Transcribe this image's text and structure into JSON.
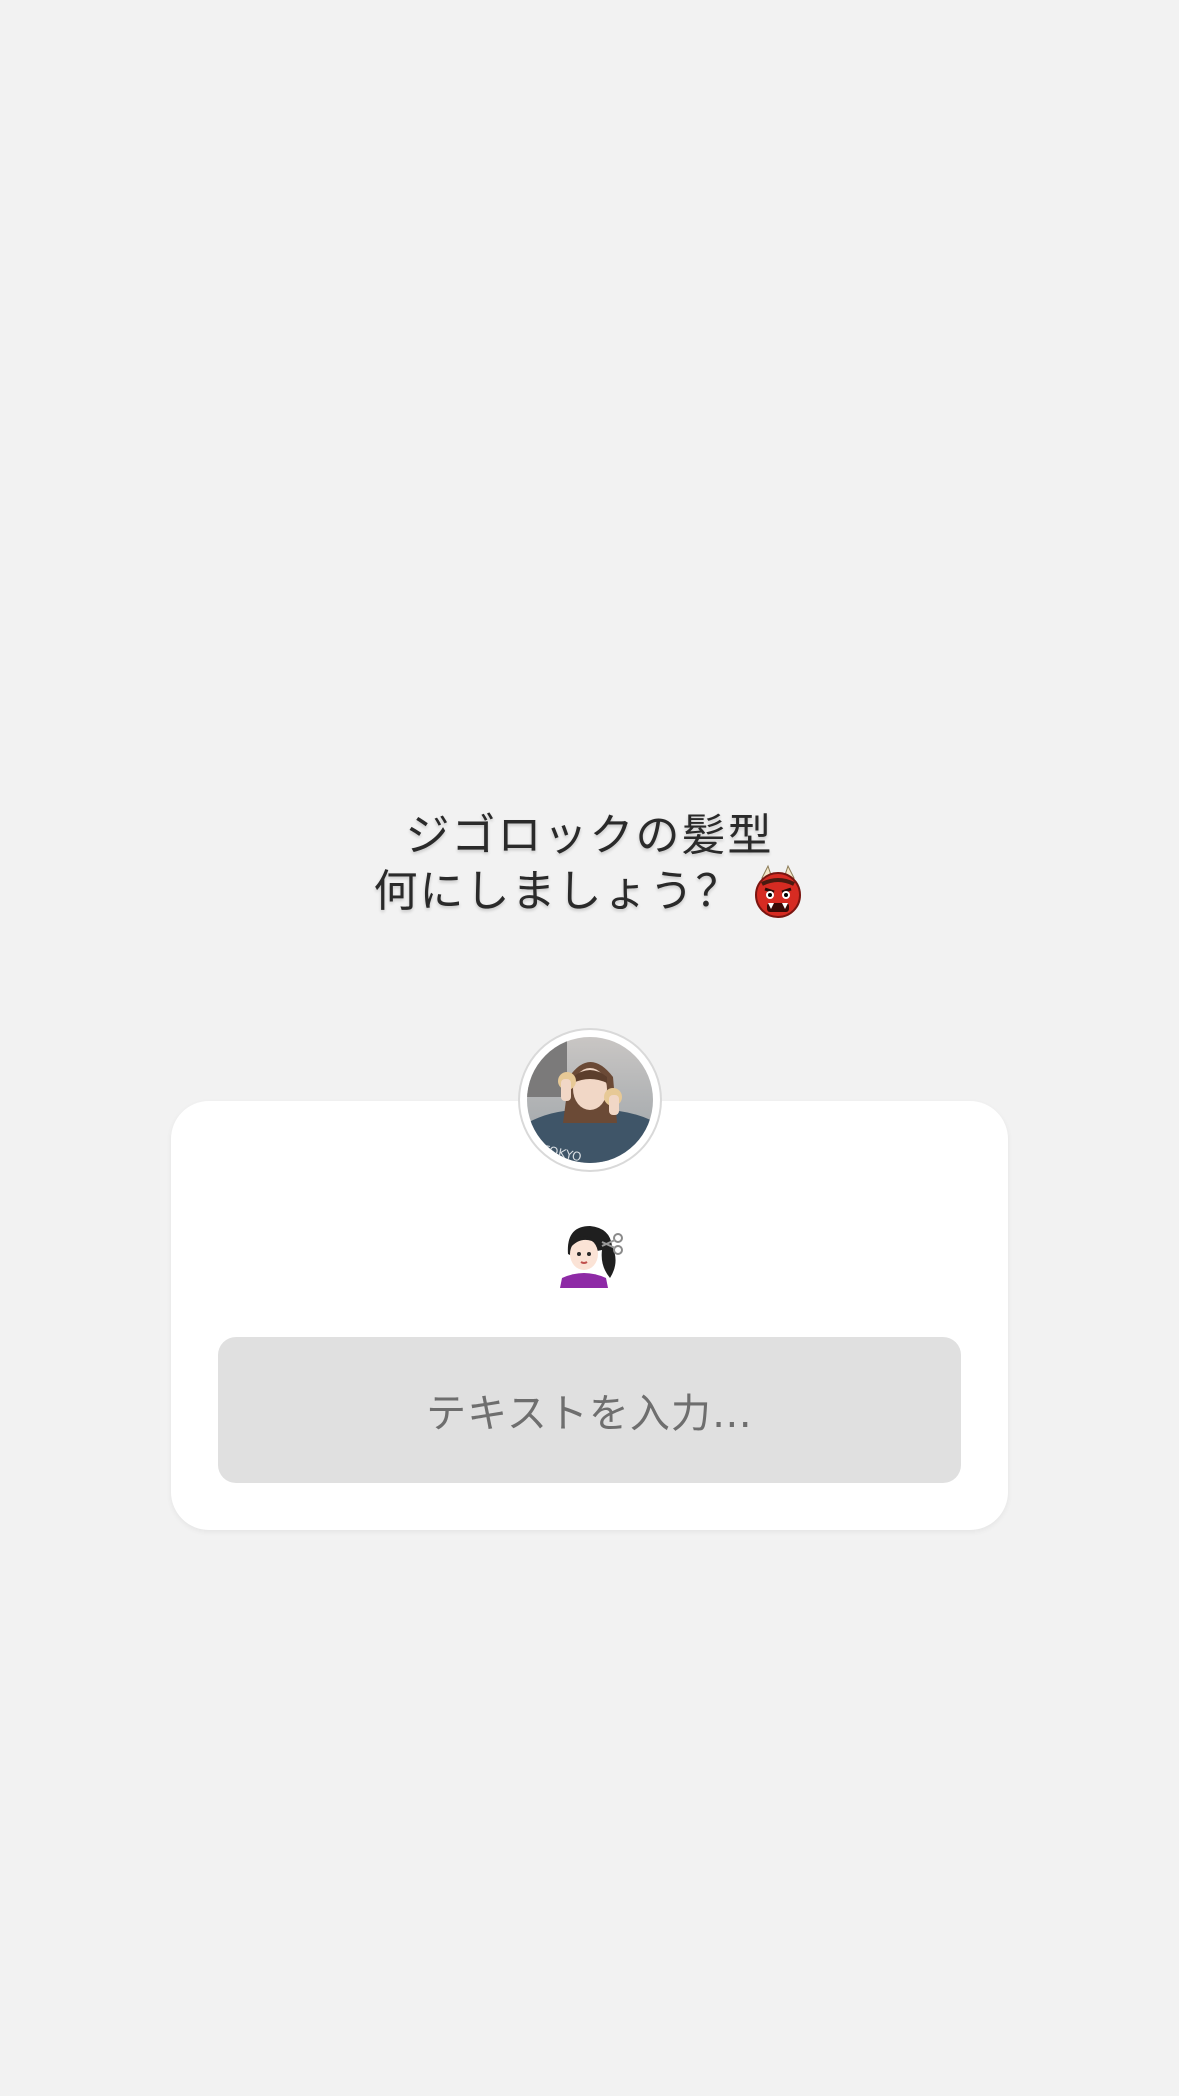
{
  "question": {
    "line1": "ジゴロックの髪型",
    "line2": "何にしましょう？",
    "emoji_icon": "oni-face-icon"
  },
  "card": {
    "avatar_icon": "profile-avatar",
    "reply_emoji_icon": "haircut-woman-icon",
    "input_placeholder": "テキストを入力…"
  },
  "colors": {
    "background": "#f2f2f2",
    "card": "#ffffff",
    "input": "#e0e0e0",
    "placeholder": "#6e6e6e"
  }
}
